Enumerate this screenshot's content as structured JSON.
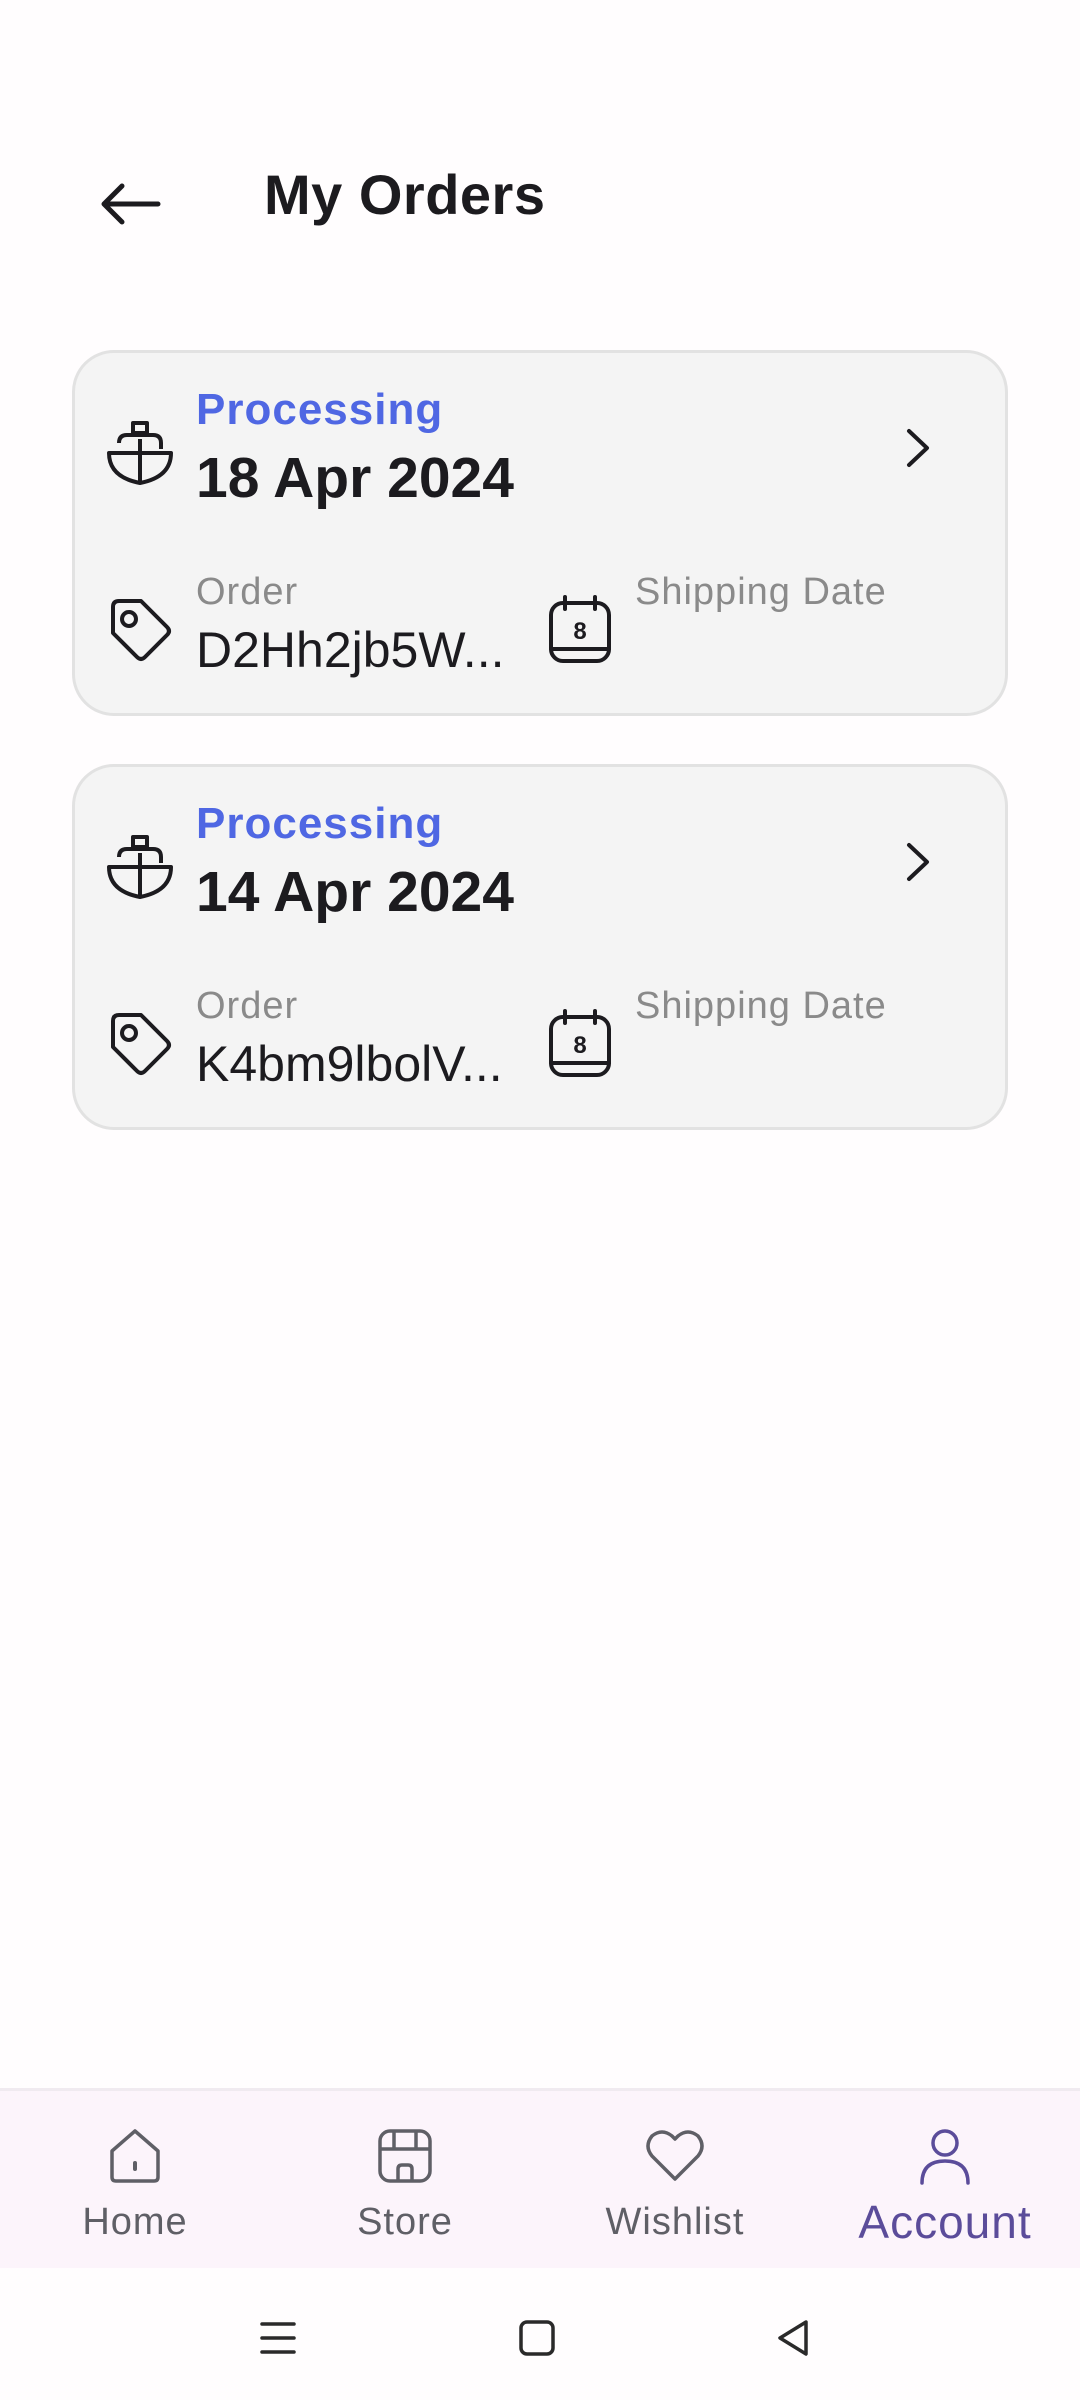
{
  "header": {
    "back_icon": "arrow-left-icon",
    "title": "My Orders"
  },
  "orders": [
    {
      "status": "Processing",
      "date": "18 Apr 2024",
      "order_label": "Order",
      "order_id": "D2Hh2jb5W...",
      "shipping_label": "Shipping Date",
      "icons": [
        "ship-icon",
        "tag-icon",
        "calendar-icon",
        "chevron-right-icon"
      ]
    },
    {
      "status": "Processing",
      "date": "14 Apr 2024",
      "order_label": "Order",
      "order_id": "K4bm9lbolV...",
      "shipping_label": "Shipping Date",
      "icons": [
        "ship-icon",
        "tag-icon",
        "calendar-icon",
        "chevron-right-icon"
      ]
    }
  ],
  "calendar_day": "8",
  "colors": {
    "status": "#4f67e3",
    "active_nav": "#5b4c9a",
    "card_bg": "#f4f4f4"
  },
  "bottom_nav": {
    "items": [
      {
        "label": "Home",
        "icon": "home-icon"
      },
      {
        "label": "Store",
        "icon": "store-icon"
      },
      {
        "label": "Wishlist",
        "icon": "heart-icon"
      },
      {
        "label": "Account",
        "icon": "user-icon",
        "active": true
      }
    ]
  },
  "system_nav": {
    "icons": [
      "menu-icon",
      "square-home-icon",
      "triangle-back-icon"
    ]
  }
}
